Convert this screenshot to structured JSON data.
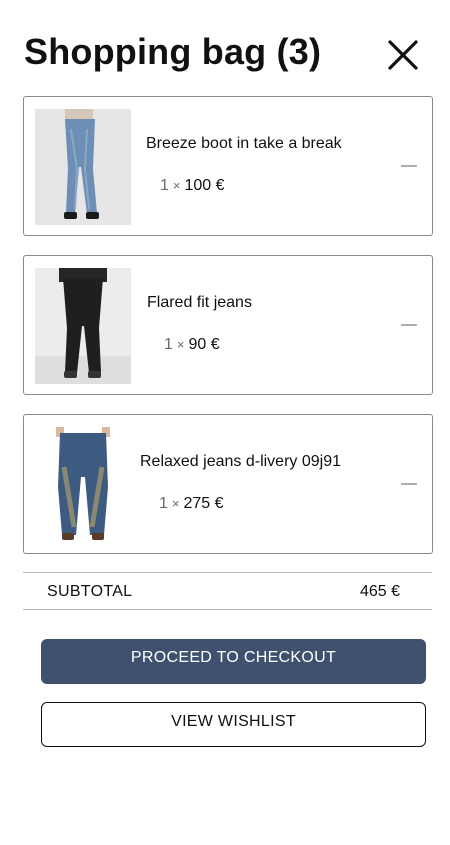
{
  "header": {
    "title": "Shopping bag (3)",
    "close_icon": "close-icon"
  },
  "items": [
    {
      "name": "Breeze boot in take a break",
      "quantity": "1",
      "times": "×",
      "price": "100 €",
      "remove_icon": "minus-icon"
    },
    {
      "name": "Flared fit jeans",
      "quantity": "1",
      "times": "×",
      "price": "90 €",
      "remove_icon": "minus-icon"
    },
    {
      "name": "Relaxed jeans d-livery 09j91",
      "quantity": "1",
      "times": "×",
      "price": "275 €",
      "remove_icon": "minus-icon"
    }
  ],
  "summary": {
    "subtotal_label": "SUBTOTAL",
    "subtotal_value": "465 €"
  },
  "actions": {
    "checkout_label": "PROCEED TO CHECKOUT",
    "wishlist_label": "VIEW WISHLIST"
  },
  "colors": {
    "primary_button": "#3f516e",
    "card_border": "#8a8a8a",
    "divider": "#b9b9b9"
  }
}
